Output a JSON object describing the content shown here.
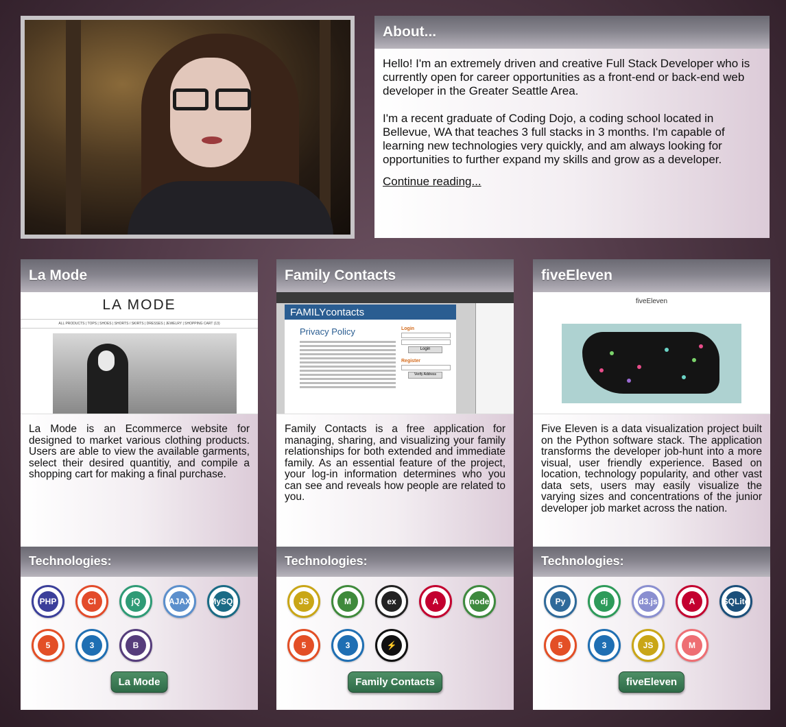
{
  "about": {
    "title": "About...",
    "para1": "Hello! I'm an extremely driven and creative Full Stack Developer who is currently open for career opportunities as a front-end or back-end web developer in the Greater Seattle Area.",
    "para2": "I'm a recent graduate of Coding Dojo, a coding school located in Bellevue, WA that teaches 3 full stacks in 3 months. I'm capable of learning new technologies very quickly, and am always looking for opportunities to further expand my skills and grow as a developer.",
    "link": "Continue reading..."
  },
  "tech_heading": "Technologies:",
  "projects": [
    {
      "title": "La Mode",
      "description": "La Mode is an Ecommerce website for designed to market various clothing products. Users are able to view the available garments, select their desired quantitiy, and compile a shopping cart for making a final purchase.",
      "button": "La Mode",
      "screenshot": {
        "site_title": "LA MODE",
        "nav": "ALL PRODUCTS | TOPS | SHOES | SHORTS / SKIRTS | DRESSES | JEWELRY | SHOPPING CART (13)"
      },
      "technologies": [
        {
          "icon": "php-icon",
          "label": "PHP",
          "color": "#3b3f9a"
        },
        {
          "icon": "codeigniter-icon",
          "label": "CI",
          "color": "#e34b2a"
        },
        {
          "icon": "jquery-icon",
          "label": "jQ",
          "color": "#2f9b76"
        },
        {
          "icon": "ajax-icon",
          "label": "AJAX",
          "color": "#5b8fcc"
        },
        {
          "icon": "mysql-icon",
          "label": "MySQL",
          "color": "#1a6b85"
        },
        {
          "icon": "html5-icon",
          "label": "5",
          "color": "#e34f26"
        },
        {
          "icon": "css3-icon",
          "label": "3",
          "color": "#1f6fb3"
        },
        {
          "icon": "bootstrap-icon",
          "label": "B",
          "color": "#563d7c"
        }
      ]
    },
    {
      "title": "Family Contacts",
      "description": "Family Contacts is a free application for managing, sharing, and visualizing your family relationships for both extended and immediate family. As an essential feature of the project, your log-in information determines who you can see and reveals how people are related to you.",
      "button": "Family Contacts",
      "screenshot": {
        "banner": "FAMILYcontacts",
        "heading": "Privacy Policy",
        "login": "Login",
        "register": "Register",
        "login_btn": "Login",
        "verify_btn": "Verify Address"
      },
      "technologies": [
        {
          "icon": "javascript-icon",
          "label": "JS",
          "color": "#c9a617"
        },
        {
          "icon": "mongodb-icon",
          "label": "M",
          "color": "#3f8a3b"
        },
        {
          "icon": "express-icon",
          "label": "ex",
          "color": "#222222"
        },
        {
          "icon": "angular-icon",
          "label": "A",
          "color": "#c3002f"
        },
        {
          "icon": "node-icon",
          "label": "node",
          "color": "#3e8a3e"
        },
        {
          "icon": "html5-icon",
          "label": "5",
          "color": "#e34f26"
        },
        {
          "icon": "css3-icon",
          "label": "3",
          "color": "#1f6fb3"
        },
        {
          "icon": "socketio-icon",
          "label": "⚡",
          "color": "#111111"
        }
      ]
    },
    {
      "title": "fiveEleven",
      "description": "Five Eleven is a data visualization project built on the Python software stack. The application transforms the developer job-hunt into a more visual, user friendly experience. Based on location, technology popularity, and other vast data sets, users may easily visualize the varying sizes and concentrations of the junior developer job market across the nation.",
      "button": "fiveEleven",
      "screenshot": {
        "site_title": "fiveEleven"
      },
      "technologies": [
        {
          "icon": "python-icon",
          "label": "Py",
          "color": "#2f6a9a"
        },
        {
          "icon": "django-icon",
          "label": "dj",
          "color": "#2e9b5a"
        },
        {
          "icon": "d3-icon",
          "label": "d3.js",
          "color": "#8a8fd0"
        },
        {
          "icon": "angular-icon",
          "label": "A",
          "color": "#c3002f"
        },
        {
          "icon": "sqlite-icon",
          "label": "SQLite",
          "color": "#1a4f7a"
        },
        {
          "icon": "html5-icon",
          "label": "5",
          "color": "#e34f26"
        },
        {
          "icon": "css3-icon",
          "label": "3",
          "color": "#1f6fb3"
        },
        {
          "icon": "javascript-icon",
          "label": "JS",
          "color": "#c9a617"
        },
        {
          "icon": "materialize-icon",
          "label": "M",
          "color": "#ee6e73"
        }
      ]
    }
  ]
}
